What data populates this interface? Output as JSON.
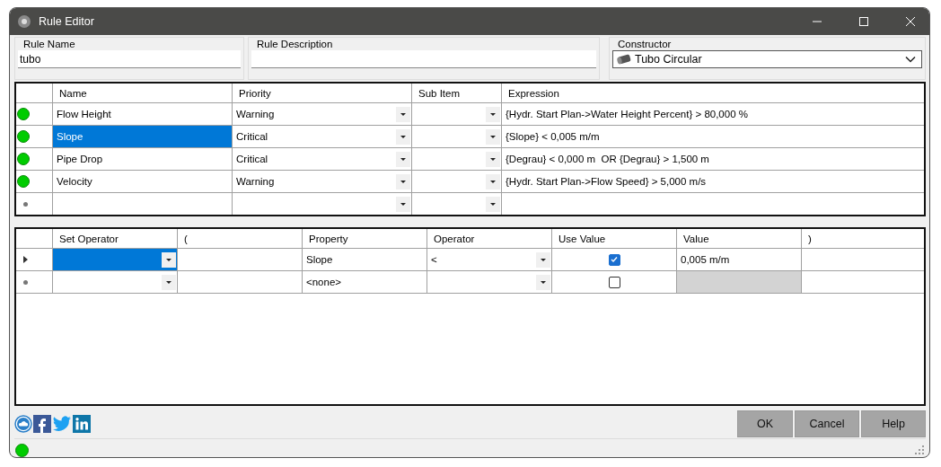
{
  "window": {
    "title": "Rule Editor"
  },
  "fields": {
    "rule_name": {
      "label": "Rule Name",
      "value": "tubo"
    },
    "rule_description": {
      "label": "Rule Description"
    },
    "constructor": {
      "label": "Constructor",
      "value": "Tubo Circular"
    }
  },
  "rules": {
    "columns": [
      "Name",
      "Priority",
      "Sub Item",
      "Expression"
    ],
    "rows": [
      {
        "kind": "rule",
        "color": "#00cc00",
        "name": "Flow Height",
        "priority": "Warning",
        "expression": "{Hydr. Start Plan->Water Height Percent} > 80,000 %",
        "selected": false
      },
      {
        "kind": "rule",
        "color": "#00cc00",
        "name": "Slope",
        "priority": "Critical",
        "expression": "{Slope} < 0,005 m/m",
        "selected": true
      },
      {
        "kind": "rule",
        "color": "#00cc00",
        "name": "Pipe Drop",
        "priority": "Critical",
        "expression": "{Degrau} < 0,000 m  OR {Degrau} > 1,500 m",
        "selected": false
      },
      {
        "kind": "rule",
        "color": "#00cc00",
        "name": "Velocity",
        "priority": "Warning",
        "expression": "{Hydr. Start Plan->Flow Speed} > 5,000 m/s",
        "selected": false
      },
      {
        "kind": "new",
        "selected": false
      }
    ]
  },
  "conditions": {
    "columns": [
      "Set Operator",
      "(",
      "Property",
      "Operator",
      "Use Value",
      "Value",
      ")"
    ],
    "rows": [
      {
        "current": true,
        "selected": true,
        "property": "Slope",
        "operator": "<",
        "use_value": true,
        "value": "0,005 m/m"
      },
      {
        "current": false,
        "selected": false,
        "property": "<none>",
        "use_value": false
      }
    ]
  },
  "buttons": [
    "OK",
    "Cancel",
    "Help"
  ],
  "status_bar": {
    "color": "#00cc00"
  }
}
